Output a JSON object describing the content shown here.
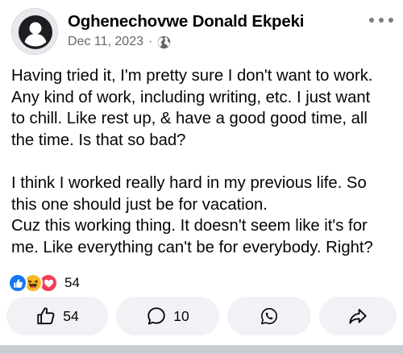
{
  "post": {
    "author": "Oghenechovwe Donald Ekpeki",
    "date": "Dec 11, 2023",
    "separator": "·",
    "privacy_icon": "globe-icon",
    "more_icon": "more-dots-icon",
    "paragraphs": [
      [
        "Having tried it, I'm pretty sure I don't want to work.",
        "Any kind of work, including writing, etc. I just want",
        "to chill. Like rest up, & have a good good time, all",
        "the time. Is that so bad?"
      ],
      [
        "I think I worked really hard in my previous life. So",
        "this one should just be for vacation.",
        "Cuz this working thing. It doesn't seem like it's for",
        "me. Like everything can't be for everybody. Right?"
      ]
    ]
  },
  "reactions": {
    "icons": [
      "like-reaction-icon",
      "haha-reaction-icon",
      "love-reaction-icon"
    ],
    "count": "54"
  },
  "actions": {
    "like_count": "54",
    "comment_count": "10"
  },
  "colors": {
    "like_blue": "#1877f2",
    "haha_yellow": "#f7b928",
    "love_red": "#f33e58",
    "pill_bg": "#f0f2f5",
    "meta_gray": "#65676b"
  }
}
